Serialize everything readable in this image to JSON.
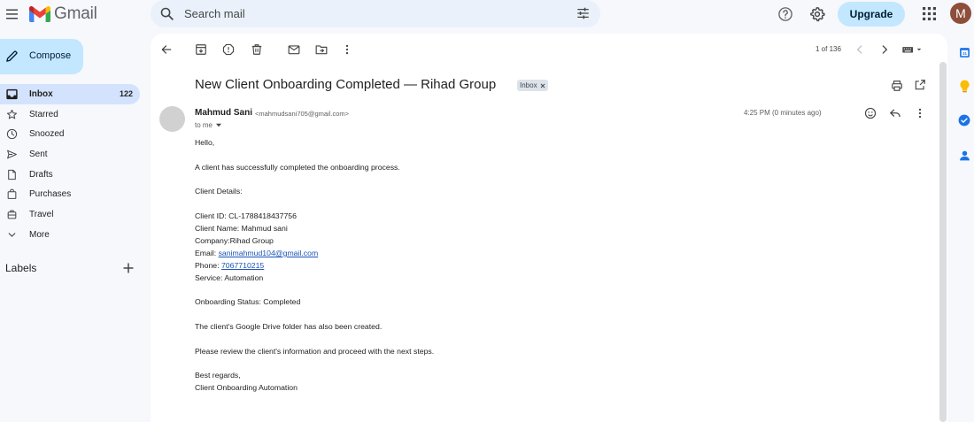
{
  "app": {
    "name": "Gmail",
    "avatar_letter": "M"
  },
  "search": {
    "placeholder": "Search mail"
  },
  "header": {
    "upgrade_label": "Upgrade"
  },
  "sidebar": {
    "compose_label": "Compose",
    "items": [
      {
        "label": "Inbox",
        "count": "122",
        "icon": "inbox-icon",
        "active": true
      },
      {
        "label": "Starred",
        "count": "",
        "icon": "star-icon"
      },
      {
        "label": "Snoozed",
        "count": "",
        "icon": "clock-icon"
      },
      {
        "label": "Sent",
        "count": "",
        "icon": "send-icon"
      },
      {
        "label": "Drafts",
        "count": "",
        "icon": "draft-icon"
      },
      {
        "label": "Purchases",
        "count": "",
        "icon": "purchases-icon"
      },
      {
        "label": "Travel",
        "count": "",
        "icon": "travel-icon"
      },
      {
        "label": "More",
        "count": "",
        "icon": "chevron-down-icon"
      }
    ],
    "labels_title": "Labels"
  },
  "toolbar": {
    "pager": "1 of 136"
  },
  "email": {
    "subject": "New Client Onboarding Completed — Rihad Group",
    "label_chip": "Inbox",
    "sender_name": "Mahmud Sani",
    "sender_email": "<mahmudsani705@gmail.com>",
    "to": "to me",
    "timestamp": "4:25 PM (0 minutes ago)",
    "body": {
      "greeting": "Hello,",
      "intro": "A client has successfully completed the onboarding process.",
      "details_title": "Client Details:",
      "client_id": "Client ID: CL-1788418437756",
      "client_name": "Client Name: Mahmud sani",
      "company": "Company:Rihad Group",
      "email_label": "Email: ",
      "email_value": "sanimahmud104@gmail.com",
      "phone_label": "Phone: ",
      "phone_value": "7067710215",
      "service": "Service: Automation",
      "status": "Onboarding Status: Completed",
      "drive_note": "The client's Google Drive folder has also been created.",
      "review_note": "Please review the client's information and proceed with the next steps.",
      "sign_off": "Best regards,",
      "signature": "Client Onboarding Automation"
    }
  },
  "colors": {
    "background": "#f6f8fc",
    "search_bg": "#eaf1fb",
    "accent": "#c2e7ff",
    "active_nav": "#d3e3fd",
    "link": "#1a53b8",
    "avatar": "#8d4e3a"
  }
}
